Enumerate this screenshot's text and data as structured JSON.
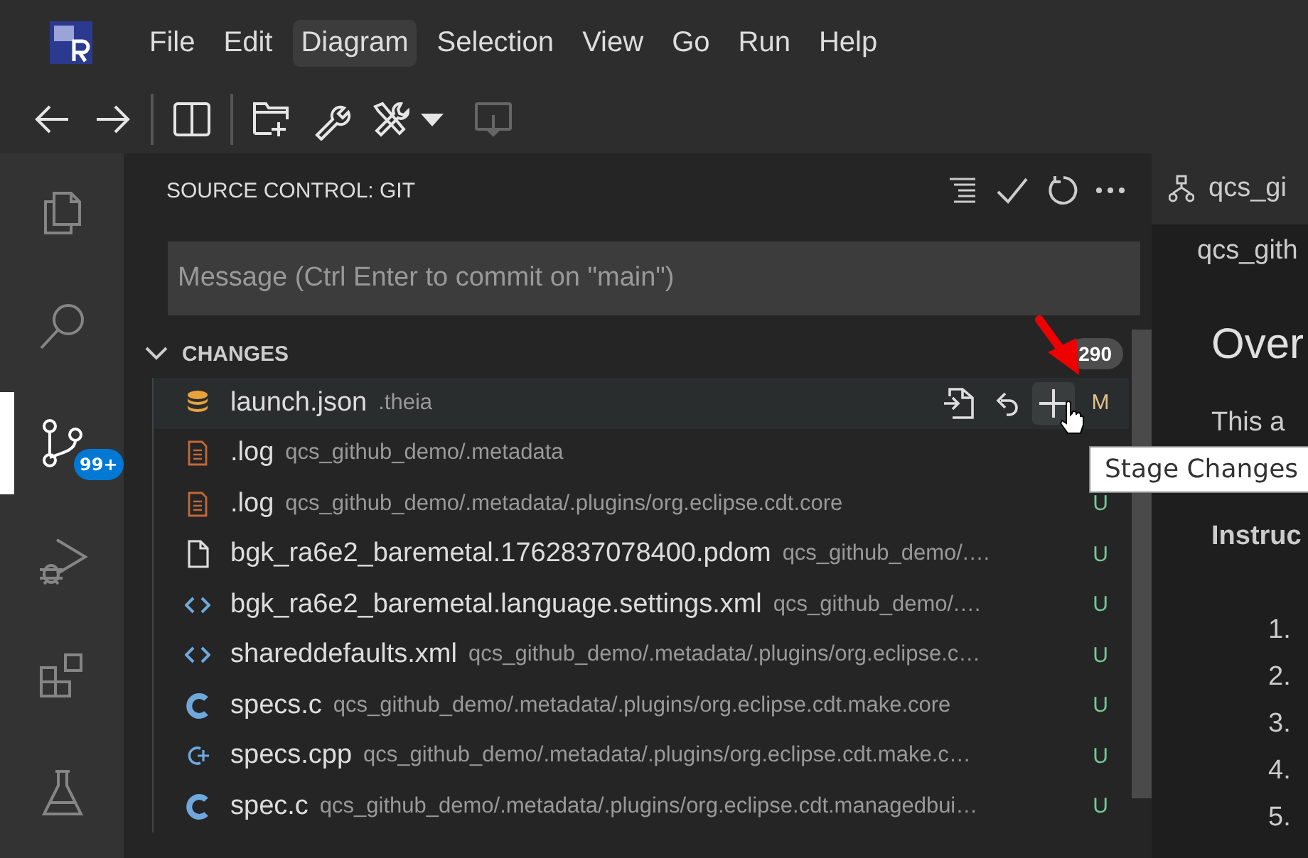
{
  "menu": [
    {
      "label": "File",
      "selected": false
    },
    {
      "label": "Edit",
      "selected": false
    },
    {
      "label": "Diagram",
      "selected": true
    },
    {
      "label": "Selection",
      "selected": false
    },
    {
      "label": "View",
      "selected": false
    },
    {
      "label": "Go",
      "selected": false
    },
    {
      "label": "Run",
      "selected": false
    },
    {
      "label": "Help",
      "selected": false
    }
  ],
  "toolbar": [
    {
      "kind": "back",
      "disabled": false
    },
    {
      "kind": "forward",
      "disabled": false
    },
    {
      "kind": "separator"
    },
    {
      "kind": "split",
      "disabled": false
    },
    {
      "kind": "separator"
    },
    {
      "kind": "newfolder",
      "disabled": false
    },
    {
      "kind": "wrench",
      "disabled": false
    },
    {
      "kind": "tools",
      "disabled": false
    },
    {
      "kind": "monitor",
      "disabled": true
    }
  ],
  "activity_bar": [
    {
      "kind": "explorer",
      "selected": false
    },
    {
      "kind": "search",
      "selected": false
    },
    {
      "kind": "scm",
      "selected": true,
      "badge": "99+"
    },
    {
      "kind": "debug",
      "selected": false
    },
    {
      "kind": "extensions",
      "selected": false
    },
    {
      "kind": "testing",
      "selected": false
    }
  ],
  "source_control": {
    "title": "SOURCE CONTROL: GIT",
    "message": {
      "placeholder": "Message (Ctrl Enter to commit on \"main\")"
    },
    "changes": {
      "label": "CHANGES",
      "expanded": true,
      "count": "290",
      "files": [
        {
          "kind": "database",
          "name": "launch.json",
          "path": ".theia",
          "status": "M",
          "color": "#e2c08d",
          "selected": true
        },
        {
          "kind": "log",
          "name": ".log",
          "path": "qcs_github_demo/.metadata",
          "selected": false
        },
        {
          "kind": "log",
          "name": ".log",
          "path": "qcs_github_demo/.metadata/.plugins/org.eclipse.cdt.core",
          "status": "U",
          "color": "#73c991",
          "selected": false
        },
        {
          "kind": "file",
          "name": "bgk_ra6e2_baremetal.1762837078400.pdom",
          "path": "qcs_github_demo/.…",
          "status": "U",
          "color": "#73c991",
          "selected": false
        },
        {
          "kind": "xml",
          "name": "bgk_ra6e2_baremetal.language.settings.xml",
          "path": "qcs_github_demo/.…",
          "status": "U",
          "color": "#73c991",
          "selected": false
        },
        {
          "kind": "xml",
          "name": "shareddefaults.xml",
          "path": "qcs_github_demo/.metadata/.plugins/org.eclipse.c…",
          "status": "U",
          "color": "#73c991",
          "selected": false
        },
        {
          "kind": "c",
          "name": "specs.c",
          "path": "qcs_github_demo/.metadata/.plugins/org.eclipse.cdt.make.core",
          "status": "U",
          "color": "#73c991",
          "selected": false
        },
        {
          "kind": "cpp",
          "name": "specs.cpp",
          "path": "qcs_github_demo/.metadata/.plugins/org.eclipse.cdt.make.c…",
          "status": "U",
          "color": "#73c991",
          "selected": false
        },
        {
          "kind": "c",
          "name": "spec.c",
          "path": "qcs_github_demo/.metadata/.plugins/org.eclipse.cdt.managedbui…",
          "status": "U",
          "color": "#73c991",
          "selected": false
        }
      ]
    },
    "tooltip": "Stage Changes"
  },
  "editor": {
    "tab": "qcs_gi",
    "breadcrumb": "qcs_gith",
    "heading": "Over",
    "paragraph": "This a",
    "bold_label": "Instruc",
    "list": [
      "1.",
      "2.",
      "3.",
      "4.",
      "5."
    ]
  }
}
